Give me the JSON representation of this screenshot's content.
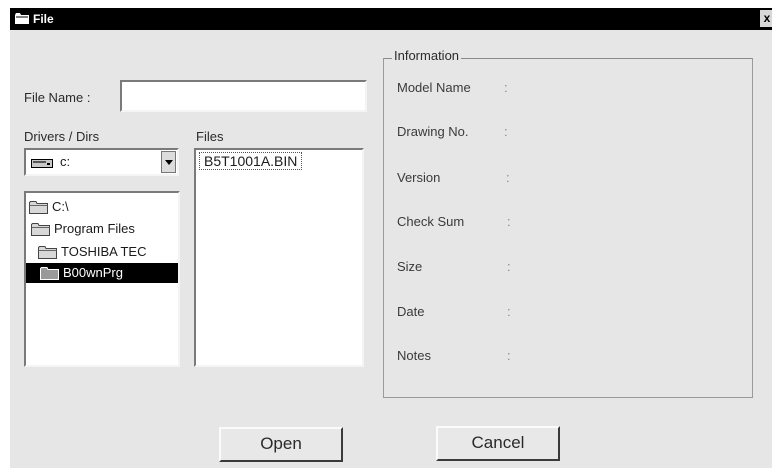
{
  "window": {
    "title": "File",
    "close_glyph": "x"
  },
  "file_name": {
    "label": "File Name :",
    "value": "",
    "placeholder": ""
  },
  "drivers": {
    "label": "Drivers / Dirs",
    "selected_drive": "c:",
    "dirs": [
      {
        "label": "C:\\",
        "selected": false
      },
      {
        "label": "Program Files",
        "selected": false
      },
      {
        "label": "TOSHIBA TEC",
        "selected": false
      },
      {
        "label": "B00wnPrg",
        "selected": true
      }
    ]
  },
  "files": {
    "label": "Files",
    "items": [
      "B5T1001A.BIN"
    ]
  },
  "information": {
    "legend": "Information",
    "fields": [
      {
        "label": "Model Name",
        "value": ""
      },
      {
        "label": "Drawing No.",
        "value": ""
      },
      {
        "label": "Version",
        "value": ""
      },
      {
        "label": "Check Sum",
        "value": ""
      },
      {
        "label": "Size",
        "value": ""
      },
      {
        "label": "Date",
        "value": ""
      },
      {
        "label": "Notes",
        "value": ""
      }
    ]
  },
  "buttons": {
    "open": "Open",
    "cancel": "Cancel"
  },
  "icons": {
    "title": "folder-icon",
    "drive": "hard-drive-icon",
    "dir": "folder-icon",
    "dropdown": "chevron-down-icon"
  },
  "colors": {
    "titlebar": "#000000",
    "window": "#e6e6e6",
    "selection": "#000000"
  }
}
